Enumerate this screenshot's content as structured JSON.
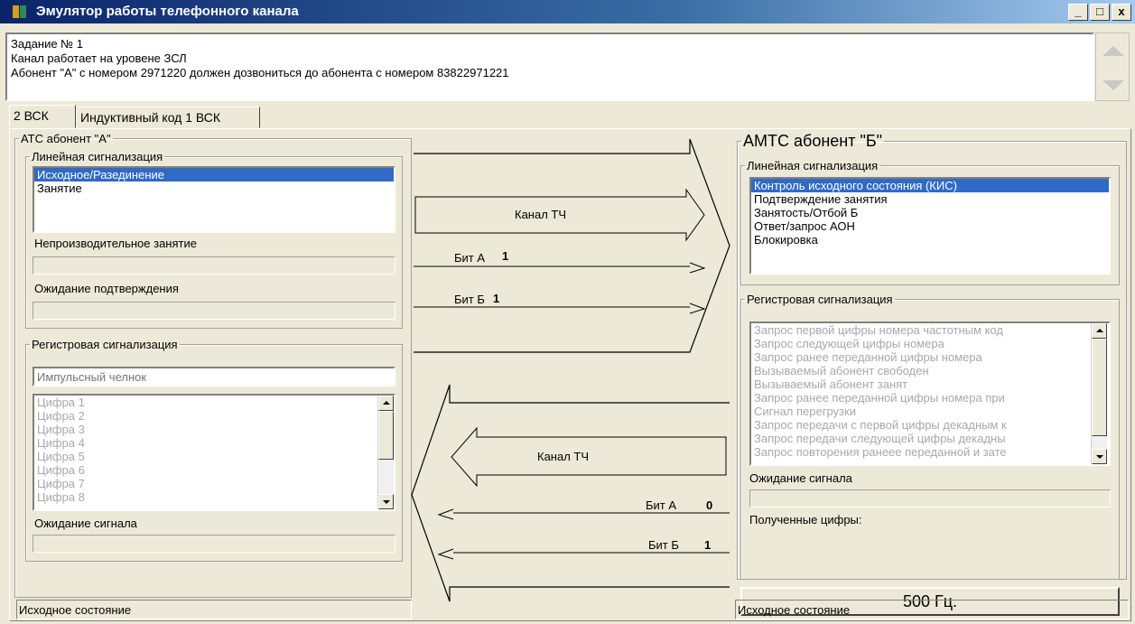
{
  "window": {
    "title": "Эмулятор работы телефонного канала",
    "buttons": [
      "_",
      "□",
      "x"
    ]
  },
  "task": {
    "lines": [
      "Задание № 1",
      "Канал работает на уровене ЗСЛ",
      "Абонент \"А\" с номером 2971220 должен дозвониться до абонента с номером 83822971221"
    ]
  },
  "tabs": [
    {
      "label": "2 ВСК"
    },
    {
      "label": "Индуктивный код 1 ВСК"
    }
  ],
  "left": {
    "title": "АТС  абонент \"А\"",
    "line_signaling": {
      "title": "Линейная сигнализация",
      "items": [
        "Исходное/Разединение",
        "Занятие"
      ],
      "selected_index": 0
    },
    "unproductive_label": "Непроизводительное занятие",
    "await_confirm_label": "Ожидание подтверждения",
    "register_signaling": {
      "title": "Регистровая сигнализация",
      "input_placeholder": "Импульсный челнок",
      "digits": [
        "Цифра 1",
        "Цифра 2",
        "Цифра 3",
        "Цифра 4",
        "Цифра 5",
        "Цифра 6",
        "Цифра 7",
        "Цифра 8"
      ]
    },
    "await_signal_label": "Ожидание сигнала",
    "status": "Исходное состояние"
  },
  "middle": {
    "forward": {
      "channel_label": "Канал ТЧ",
      "bit_a_label": "Бит А",
      "bit_a_value": "1",
      "bit_b_label": "Бит Б",
      "bit_b_value": "1"
    },
    "backward": {
      "channel_label": "Канал ТЧ",
      "bit_a_label": "Бит А",
      "bit_a_value": "0",
      "bit_b_label": "Бит Б",
      "bit_b_value": "1"
    }
  },
  "right": {
    "title": "АМТС абонент \"Б\"",
    "line_signaling": {
      "title": "Линейная сигнализация",
      "items": [
        "Контроль исходного состояния (КИС)",
        "Подтверждение занятия",
        "Занятость/Отбой Б",
        "Ответ/запрос АОН",
        "Блокировка"
      ],
      "selected_index": 0
    },
    "register_signaling": {
      "title": "Регистровая сигнализация",
      "items": [
        "Запрос первой цифры номера частотным код",
        "Запрос следующей цифры номера",
        "Запрос ранее переданной цифры номера",
        "Вызываемый абонент свободен",
        "Вызываемый абонент занят",
        "Запрос ранее переданной цифры номера при",
        "Сигнал перегрузки",
        "Запрос передачи с первой цифры декадным к",
        "Запрос передачи следующей цифры декадны",
        "Запрос повторения ранеее переданной и зате"
      ]
    },
    "await_signal_label": "Ожидание сигнала",
    "received_digits_label": "Полученные цифры:",
    "tone_button": "500 Гц.",
    "status": "Исходное состояние"
  }
}
